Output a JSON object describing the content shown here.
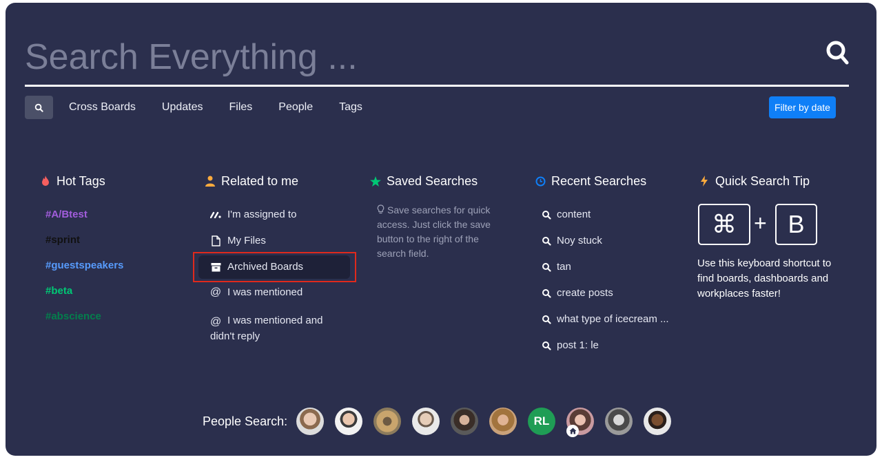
{
  "search": {
    "placeholder": "Search Everything ..."
  },
  "tabs": [
    "Cross Boards",
    "Updates",
    "Files",
    "People",
    "Tags"
  ],
  "filter_label": "Filter by date",
  "hot_tags": {
    "title": "Hot Tags",
    "items": [
      {
        "label": "#A/Btest",
        "color": "#a25ddc"
      },
      {
        "label": "#sprint",
        "color": "#111111"
      },
      {
        "label": "#guestspeakers",
        "color": "#579bfc"
      },
      {
        "label": "#beta",
        "color": "#00c875"
      },
      {
        "label": "#abscience",
        "color": "#037f4c"
      }
    ]
  },
  "related": {
    "title": "Related to me",
    "items": [
      {
        "label": "I'm assigned to",
        "icon": "monday-logo-icon"
      },
      {
        "label": "My Files",
        "icon": "file-icon"
      },
      {
        "label": "Archived Boards",
        "icon": "archive-icon"
      },
      {
        "label": "I was mentioned",
        "icon": "at-sign-icon"
      },
      {
        "label": "I was mentioned and didn't reply",
        "icon": "at-sign-icon"
      }
    ]
  },
  "saved": {
    "title": "Saved Searches",
    "text": "Save searches for quick access. Just click the save button to the right of the search field."
  },
  "recent": {
    "title": "Recent Searches",
    "items": [
      "content",
      "Noy stuck",
      "tan",
      "create posts",
      "what type of icecream ...",
      "post 1: le"
    ]
  },
  "tip": {
    "title": "Quick Search Tip",
    "key1": "⌘",
    "plus": "+",
    "key2": "B",
    "text": "Use this keyboard shortcut to find boards, dashboards and workplaces faster!"
  },
  "people": {
    "label": "People Search:",
    "initials_avatar": "RL"
  },
  "colors": {
    "panel": "#2b2f4d",
    "accent": "#0f7ff7",
    "highlight": "#e0291c"
  }
}
